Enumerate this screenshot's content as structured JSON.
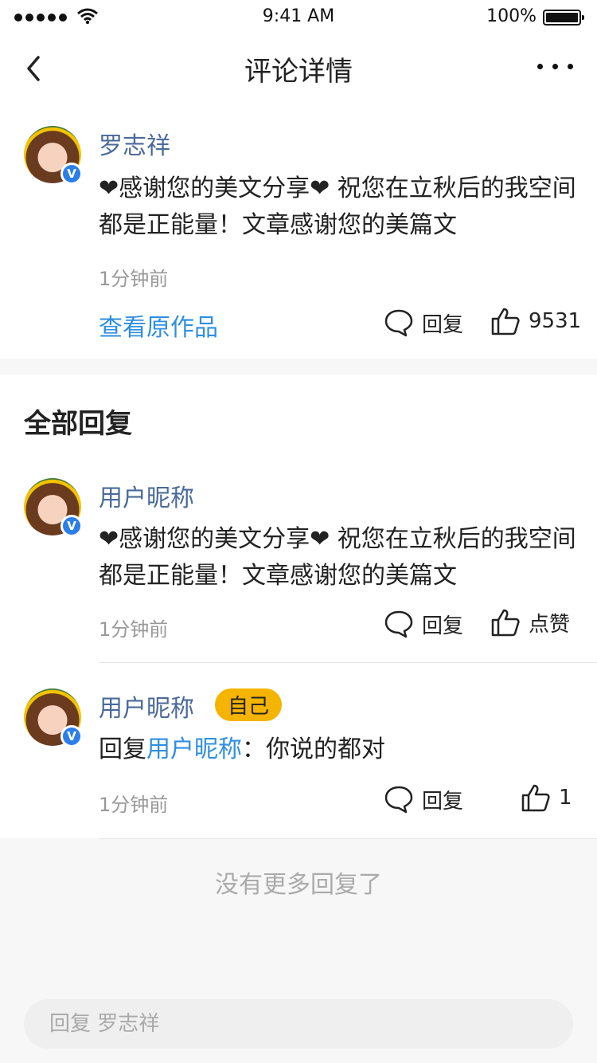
{
  "status_bar": {
    "time": "9:41 AM",
    "battery": "100%"
  },
  "nav": {
    "title": "评论详情"
  },
  "main_comment": {
    "author": "罗志祥",
    "content": "❤感谢您的美文分享❤ 祝您在立秋后的我空间都是正能量！文章感谢您的美篇文",
    "time": "1分钟前",
    "view_original": "查看原作品",
    "reply_label": "回复",
    "like_count": "9531"
  },
  "replies_section": {
    "title": "全部回复"
  },
  "replies": [
    {
      "author": "用户昵称",
      "content": "❤感谢您的美文分享❤ 祝您在立秋后的我空间都是正能量！文章感谢您的美篇文",
      "time": "1分钟前",
      "reply_label": "回复",
      "like_label": "点赞"
    },
    {
      "author": "用户昵称",
      "tag": "自己",
      "reply_prefix": "回复",
      "reply_to": "用户昵称",
      "reply_text": "：你说的都对",
      "time": "1分钟前",
      "reply_label": "回复",
      "like_count": "1"
    }
  ],
  "footer": {
    "no_more": "没有更多回复了",
    "input_placeholder": "回复 罗志祥"
  },
  "colors": {
    "accent": "#2f8fe0",
    "name": "#4a6a9a",
    "tag": "#f5b400",
    "badge": "#2b7fe8"
  },
  "icons": [
    "back-icon",
    "more-icon",
    "verified-badge-icon",
    "comment-icon",
    "thumb-up-icon",
    "wifi-icon"
  ]
}
